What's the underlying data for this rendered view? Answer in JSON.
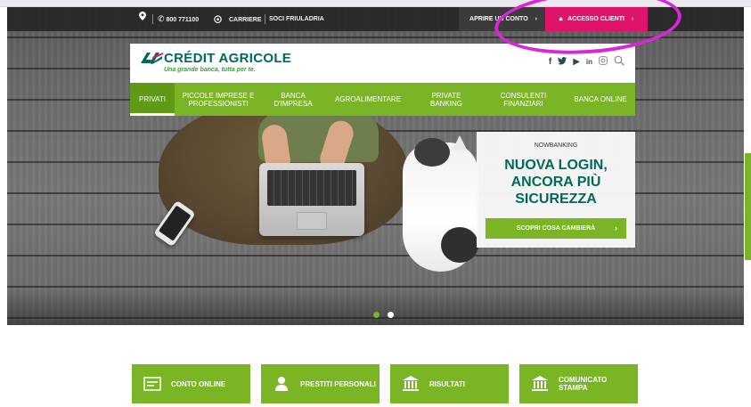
{
  "topbar": {
    "phone": "800 771100",
    "carriere": "CARRIERE",
    "soci": "SOCI FRIULADRIA",
    "apri_conto": "APRIRE UN CONTO",
    "accesso_clienti": "ACCESSO CLIENTI"
  },
  "header": {
    "brand": "CRÉDIT AGRICOLE",
    "tagline": "Una grande banca, tutta per te.",
    "social": [
      "facebook-icon",
      "twitter-icon",
      "youtube-icon",
      "linkedin-icon",
      "instagram-icon",
      "search-icon"
    ]
  },
  "nav": {
    "items": [
      {
        "label": "PRIVATI"
      },
      {
        "label": "PICCOLE IMPRESE E PROFESSIONISTI"
      },
      {
        "label": "BANCA D'IMPRESA"
      },
      {
        "label": "AGROALIMENTARE"
      },
      {
        "label": "PRIVATE BANKING"
      },
      {
        "label": "CONSULENTI FINANZIARI"
      },
      {
        "label": "BANCA ONLINE"
      }
    ],
    "active": "PRIVATI"
  },
  "promo": {
    "kicker": "NOWBANKING",
    "title": "NUOVA LOGIN, ANCORA PIÙ SICUREZZA",
    "button": "SCOPRI COSA CAMBIERÀ"
  },
  "carousel": {
    "slides": 2,
    "active": 1
  },
  "tiles": [
    {
      "label": "CONTO ONLINE",
      "icon": "card-icon"
    },
    {
      "label": "PRESTITI PERSONALI",
      "icon": "person-icon"
    },
    {
      "label": "RISULTATI",
      "icon": "bank-icon"
    },
    {
      "label": "COMUNICATO STAMPA",
      "icon": "bank-icon"
    }
  ],
  "colors": {
    "green": "#7ab526",
    "dark_green": "#00695c",
    "pink": "#e0136b",
    "annotation": "#d826d8"
  }
}
